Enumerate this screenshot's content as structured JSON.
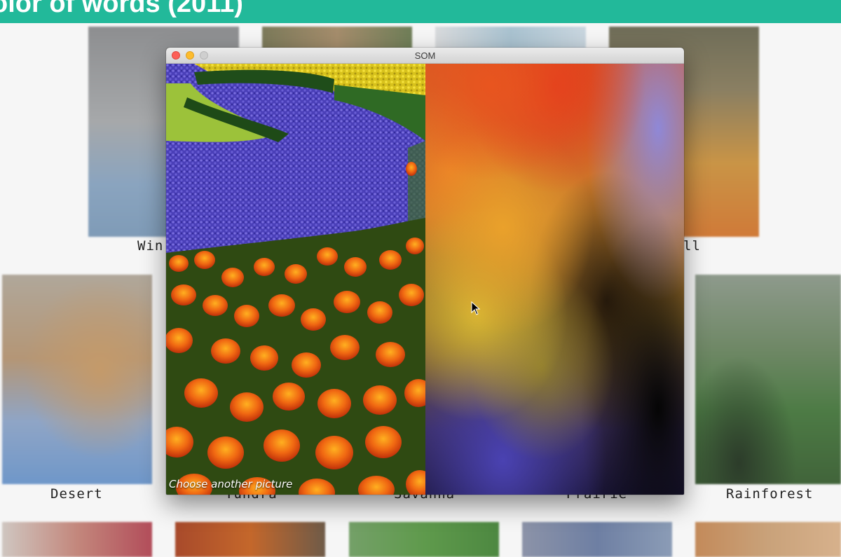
{
  "banner": {
    "title": "olor of words (2011)"
  },
  "tiles": [
    {
      "label": "Winter",
      "visible_text": "Win"
    },
    {
      "label": "Fall",
      "visible_text": "ll"
    },
    {
      "label": "Desert",
      "visible_text": "Desert"
    },
    {
      "label": "Tundra",
      "visible_text": "Tundra"
    },
    {
      "label": "Savanna",
      "visible_text": "Savanna"
    },
    {
      "label": "Prairie",
      "visible_text": "Prairie"
    },
    {
      "label": "Rainforest",
      "visible_text": "Rainforest"
    }
  ],
  "window": {
    "title": "SOM",
    "caption": "Choose another picture"
  },
  "colors": {
    "banner": "#22b99a",
    "close": "#fc5f57",
    "minimize": "#fdbc2e",
    "maximize": "#cfcfcf"
  },
  "icons": [
    "close-icon",
    "minimize-icon",
    "maximize-icon",
    "arrow-cursor-icon"
  ]
}
